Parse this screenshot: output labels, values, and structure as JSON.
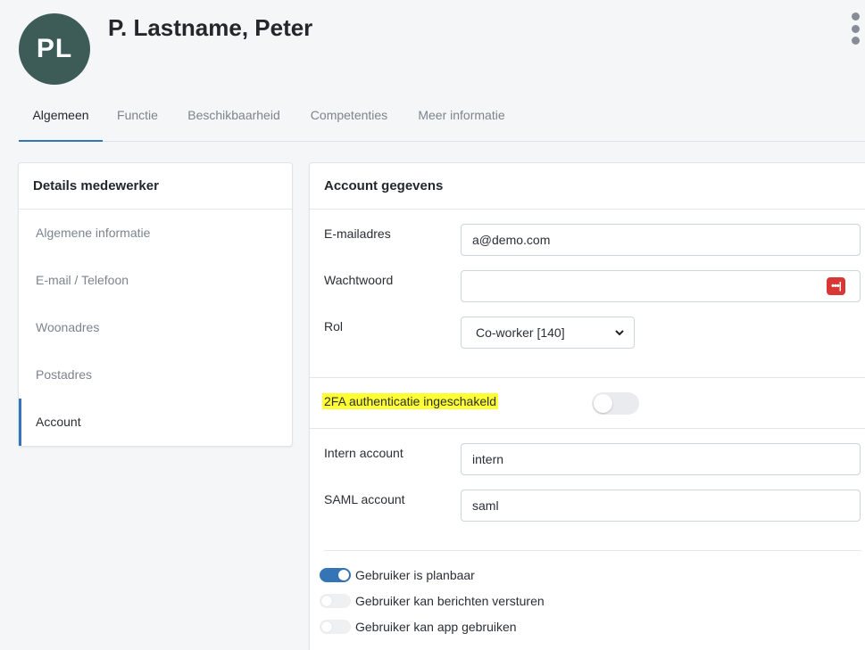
{
  "header": {
    "avatar_initials": "PL",
    "title": "P. Lastname, Peter",
    "menu_icon": "kebab-menu-icon"
  },
  "tabs": [
    {
      "label": "Algemeen",
      "active": true
    },
    {
      "label": "Functie",
      "active": false
    },
    {
      "label": "Beschikbaarheid",
      "active": false
    },
    {
      "label": "Competenties",
      "active": false
    },
    {
      "label": "Meer informatie",
      "active": false
    }
  ],
  "sidebar": {
    "title": "Details medewerker",
    "items": [
      {
        "label": "Algemene informatie",
        "active": false
      },
      {
        "label": "E-mail / Telefoon",
        "active": false
      },
      {
        "label": "Woonadres",
        "active": false
      },
      {
        "label": "Postadres",
        "active": false
      },
      {
        "label": "Account",
        "active": true
      }
    ]
  },
  "account": {
    "title": "Account gegevens",
    "email": {
      "label": "E-mailadres",
      "value": "a@demo.com"
    },
    "password": {
      "label": "Wachtwoord",
      "value": "",
      "badge": "•••|"
    },
    "role": {
      "label": "Rol",
      "selected": "Co-worker [140]"
    },
    "twofa": {
      "label": "2FA authenticatie ingeschakeld",
      "enabled": false
    },
    "intern": {
      "label": "Intern account",
      "value": "intern"
    },
    "saml": {
      "label": "SAML account",
      "value": "saml"
    },
    "toggles": [
      {
        "label": "Gebruiker is planbaar",
        "on": true
      },
      {
        "label": "Gebruiker kan berichten versturen",
        "on": false
      },
      {
        "label": "Gebruiker kan app gebruiken",
        "on": false
      }
    ]
  },
  "colors": {
    "accent": "#3574b5",
    "avatar": "#3d5c58",
    "highlight": "#ffff33",
    "password_badge": "#d93636"
  }
}
